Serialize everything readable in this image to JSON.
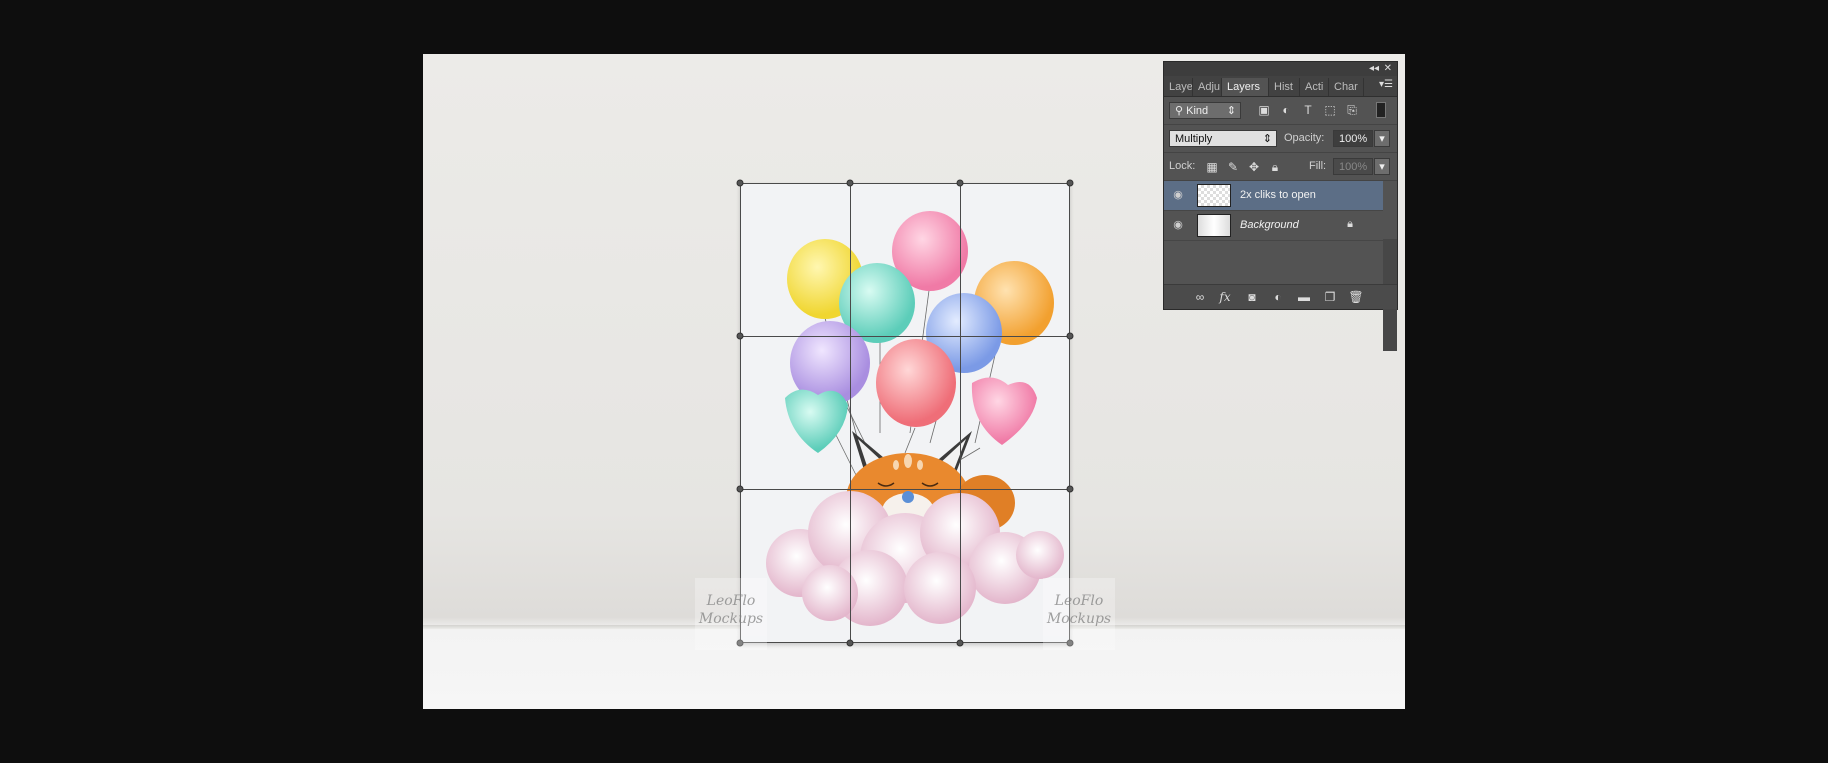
{
  "watermark": {
    "line1": "LeoFlo",
    "line2": "Mockups"
  },
  "layers_panel": {
    "collapse_glyph": "◂◂",
    "close_glyph": "✕",
    "tabs": [
      {
        "label": "Laye"
      },
      {
        "label": "Adju"
      },
      {
        "label": "Layers"
      },
      {
        "label": "Hist"
      },
      {
        "label": "Acti"
      },
      {
        "label": "Char"
      }
    ],
    "filter": {
      "label": "Kind"
    },
    "blend_mode": "Multiply",
    "opacity_label": "Opacity:",
    "opacity_value": "100%",
    "lock_label": "Lock:",
    "fill_label": "Fill:",
    "fill_value": "100%",
    "layers": [
      {
        "name": "2x cliks to open",
        "selected": true
      },
      {
        "name": "Background",
        "selected": false,
        "locked": true
      }
    ]
  }
}
